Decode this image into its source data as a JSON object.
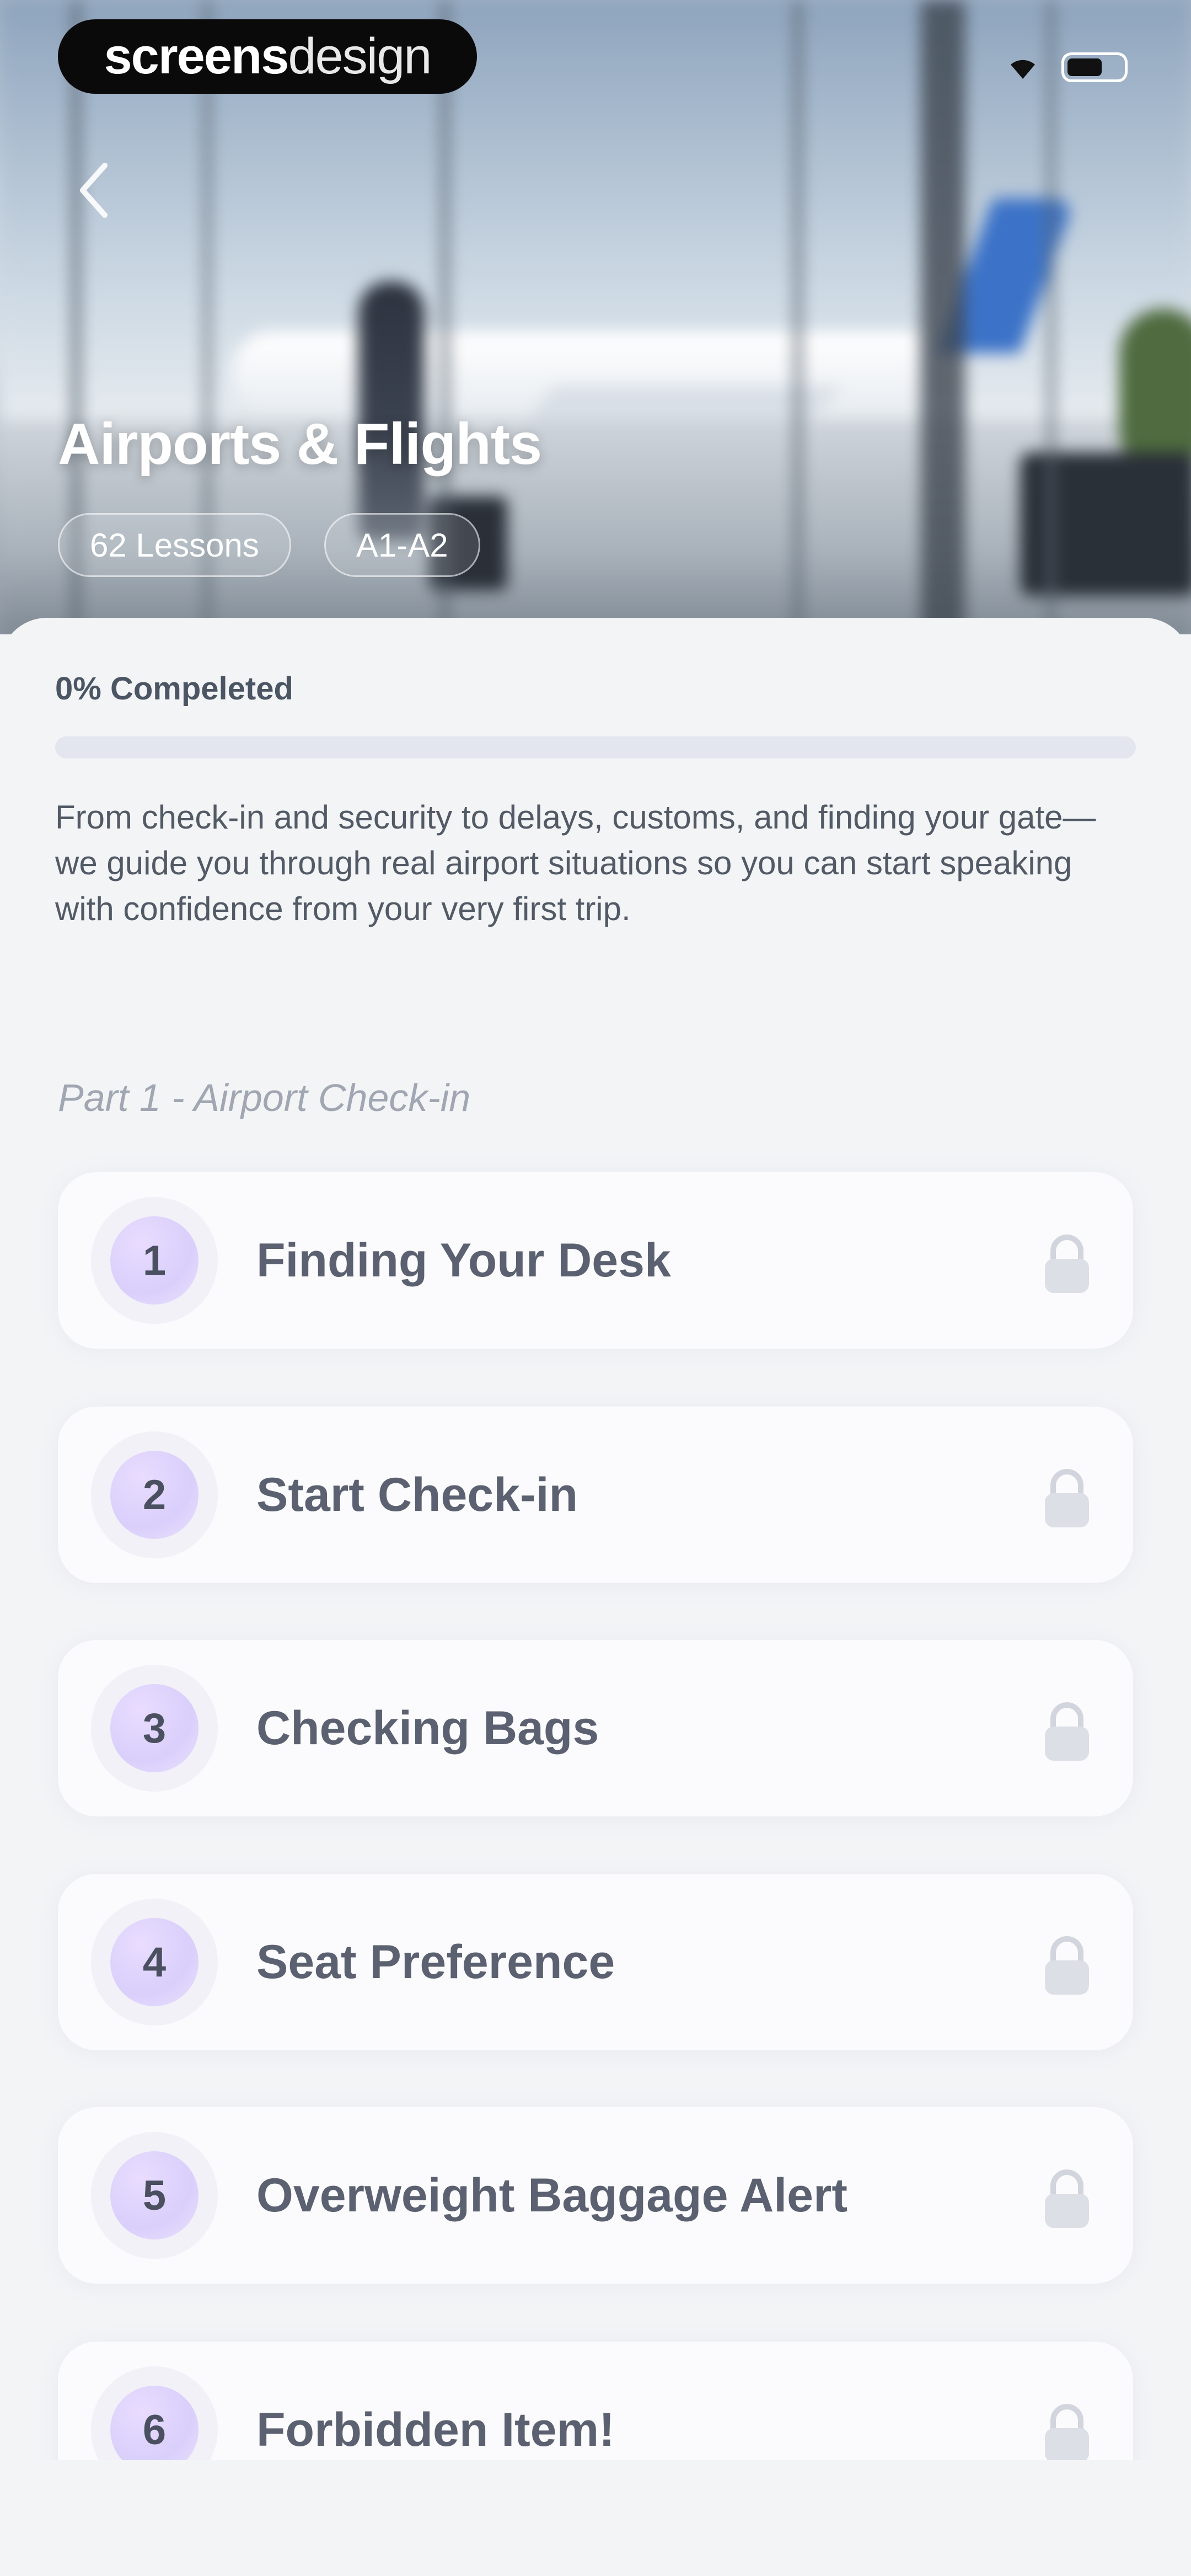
{
  "watermark": {
    "bold": "screens",
    "light": "design"
  },
  "status_bar": {
    "wifi_icon": "wifi-icon",
    "battery_icon": "battery-icon"
  },
  "header": {
    "back_icon": "chevron-left-icon",
    "title": "Airports & Flights",
    "chips": [
      "62 Lessons",
      "A1-A2"
    ]
  },
  "progress": {
    "label": "0% Compeleted",
    "value_percent": 0,
    "fill_color": "#8b7cf6"
  },
  "description": "From check-in and security to delays, customs, and finding your gate—we guide you through real airport situations so you can start speaking with confidence from your very first trip.",
  "part": {
    "heading": "Part 1 - Airport Check-in"
  },
  "lessons": [
    {
      "number": "1",
      "title": "Finding Your Desk",
      "locked": true
    },
    {
      "number": "2",
      "title": "Start Check-in",
      "locked": true
    },
    {
      "number": "3",
      "title": "Checking Bags",
      "locked": true
    },
    {
      "number": "4",
      "title": "Seat Preference",
      "locked": true
    },
    {
      "number": "5",
      "title": "Overweight Baggage Alert",
      "locked": true
    },
    {
      "number": "6",
      "title": "Forbidden Item!",
      "locked": true
    }
  ]
}
